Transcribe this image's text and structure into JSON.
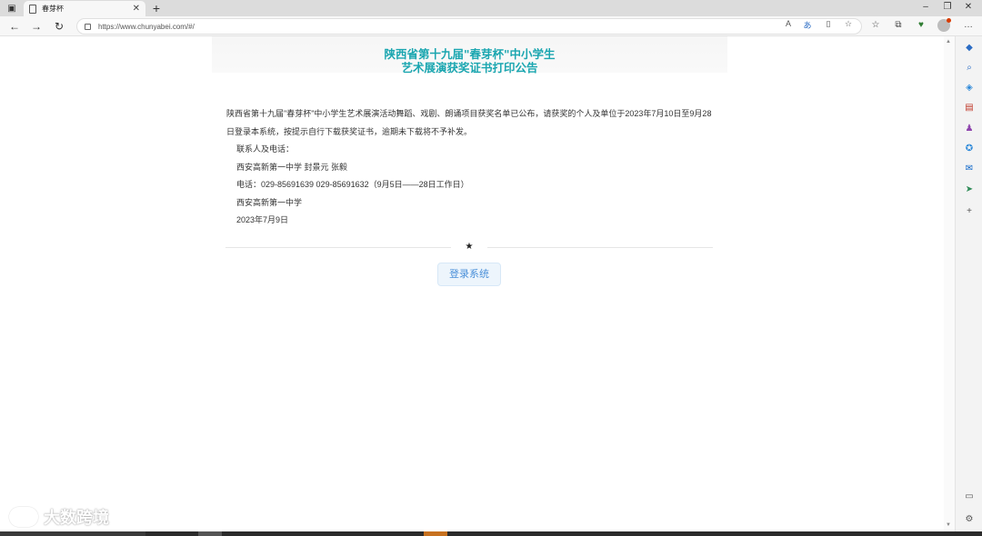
{
  "browser": {
    "tab_title": "春芽杯",
    "tab_close": "✕",
    "new_tab": "+",
    "url": "https://www.chunyabei.com/#/"
  },
  "page": {
    "title_line1": "陕西省第十九届\"春芽杯\"中小学生",
    "title_line2": "艺术展演获奖证书打印公告",
    "body_para": "陕西省第十九届\"春芽杯\"中小学生艺术展演活动舞蹈、戏剧、朗诵项目获奖名单已公布，请获奖的个人及单位于2023年7月10日至9月28日登录本系统，按提示自行下载获奖证书，逾期未下载将不予补发。",
    "contact_label": "联系人及电话：",
    "contact_people": "西安高新第一中学 封景元 张毅",
    "contact_phone": "电话：029-85691639 029-85691632（9月5日——28日工作日）",
    "org": "西安高新第一中学",
    "date": "2023年7月9日",
    "divider_star": "★",
    "login_button": "登录系统"
  },
  "watermark": {
    "text": "大数跨境"
  },
  "colors": {
    "title": "#1aa6b0",
    "button_text": "#4a90d9",
    "button_bg": "#edf5fc"
  }
}
